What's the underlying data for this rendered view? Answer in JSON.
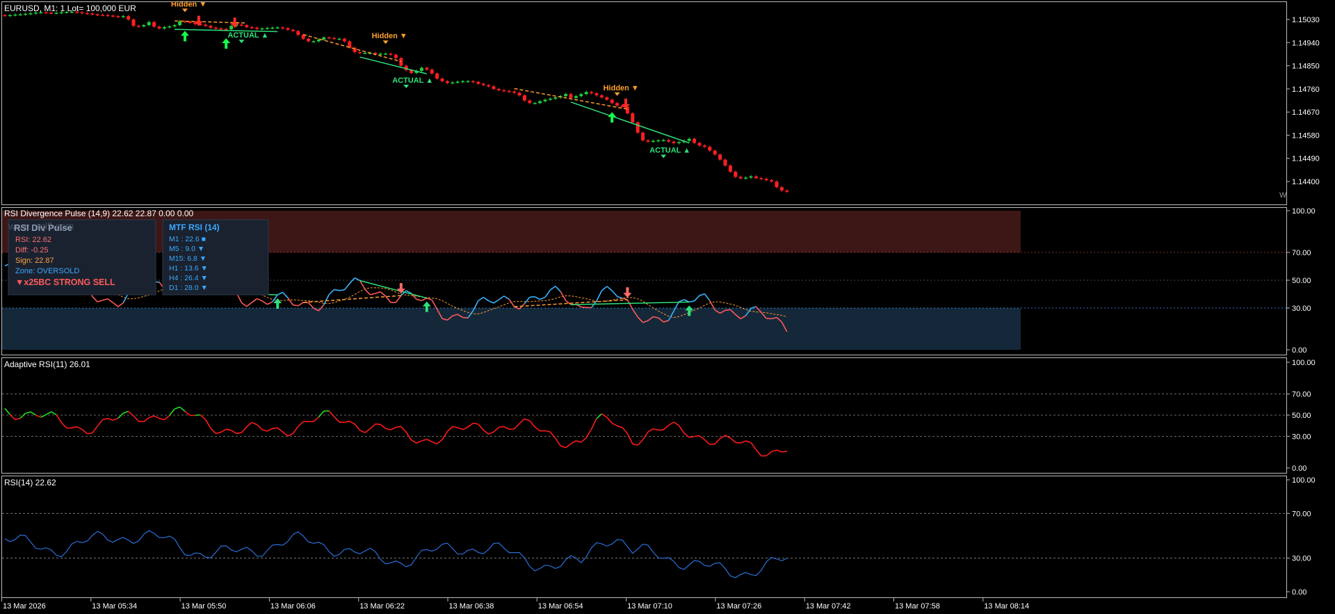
{
  "main": {
    "header": "EURUSD, M1:  1 Lot= 100,000 EUR",
    "price_ticks": [
      "1.15030",
      "1.14940",
      "1.14850",
      "1.14760",
      "1.14670",
      "1.14580",
      "1.14490",
      "1.14400"
    ],
    "labels": [
      {
        "text": "Hidden ▼",
        "kind": "hidden"
      },
      {
        "text": "Hidden ▼",
        "kind": "hidden"
      },
      {
        "text": "Hidden ▼",
        "kind": "hidden"
      },
      {
        "text": "ACTUAL ▲",
        "kind": "actual"
      },
      {
        "text": "ACTUAL ▲",
        "kind": "actual"
      },
      {
        "text": "ACTUAL ▲",
        "kind": "actual"
      }
    ],
    "corner_text": "W"
  },
  "rsi_div": {
    "header": "RSI Divergence Pulse (14,9) 22.62 22.87 0.00 0.00",
    "ticks": [
      "100.00",
      "70.00",
      "50.00",
      "30.00",
      "0.00"
    ],
    "watermark": "www.mql5.com",
    "info_panel": {
      "title": "RSI Div Pulse",
      "rows": [
        {
          "label": "RSI:  22.62",
          "color": "#ff6e6e"
        },
        {
          "label": "Diff: -0.25",
          "color": "#ff6e6e"
        },
        {
          "label": "Sign: 22.87",
          "color": "#ffa040"
        },
        {
          "label": "Zone: OVERSOLD",
          "color": "#3aa8ff"
        }
      ],
      "signal": "▼x25BC STRONG SELL"
    },
    "mtf_panel": {
      "title": "MTF RSI (14)",
      "rows": [
        "M1  : 22.6 ■",
        "M5  : 9.0 ▼",
        "M15: 6.8 ▼",
        "H1  : 13.6 ▼",
        "H4  : 26.4 ▼",
        "D1  : 28.0 ▼"
      ]
    }
  },
  "adaptive": {
    "header": "Adaptive RSI(11) 26.01",
    "ticks": [
      "100.00",
      "70.00",
      "50.00",
      "30.00",
      "0.00"
    ]
  },
  "rsi14": {
    "header": "RSI(14) 22.62",
    "ticks": [
      "100.00",
      "70.00",
      "30.00",
      "0.00"
    ]
  },
  "time_axis": [
    "13 Mar 2026",
    "13 Mar 05:34",
    "13 Mar 05:50",
    "13 Mar 06:06",
    "13 Mar 06:22",
    "13 Mar 06:38",
    "13 Mar 06:54",
    "13 Mar 07:10",
    "13 Mar 07:26",
    "13 Mar 07:42",
    "13 Mar 07:58",
    "13 Mar 08:14"
  ],
  "chart_data": {
    "type": "candlestick",
    "symbol": "EURUSD",
    "timeframe": "M1",
    "close_approx": [
      1.15045,
      1.15047,
      1.15049,
      1.1505,
      1.15052,
      1.15054,
      1.15057,
      1.15058,
      1.15056,
      1.15055,
      1.15056,
      1.15058,
      1.15059,
      1.1506,
      1.15058,
      1.15055,
      1.15053,
      1.1505,
      1.15048,
      1.15047,
      1.15045,
      1.15043,
      1.1504,
      1.15043,
      1.1503,
      1.15005,
      1.15003,
      1.15008,
      1.1502,
      1.15002,
      1.14995,
      1.15,
      1.15003,
      1.15008,
      1.15023,
      1.15021,
      1.15018,
      1.15012,
      1.1501,
      1.15005,
      1.14998,
      1.14995,
      1.14993,
      1.14992,
      1.15005,
      1.1501,
      1.15008,
      1.15,
      1.14998,
      1.14993,
      1.14995,
      1.14997,
      1.14998,
      1.14999,
      1.14996,
      1.1499,
      1.14985,
      1.1497,
      1.14955,
      1.14945,
      1.14945,
      1.14952,
      1.1496,
      1.14958,
      1.14955,
      1.14955,
      1.14945,
      1.1492,
      1.14903,
      1.149,
      1.149,
      1.149,
      1.14895,
      1.14897,
      1.14897,
      1.14893,
      1.1488,
      1.1485,
      1.14833,
      1.14822,
      1.1483,
      1.14842,
      1.14835,
      1.1482,
      1.148,
      1.1479,
      1.14783,
      1.14785,
      1.14788,
      1.1479,
      1.1479,
      1.14787,
      1.1478,
      1.14775,
      1.1477,
      1.1476,
      1.14755,
      1.14752,
      1.1475,
      1.14745,
      1.14735,
      1.14715,
      1.14705,
      1.14705,
      1.14712,
      1.14718,
      1.14722,
      1.14727,
      1.14732,
      1.1474,
      1.14725,
      1.14732,
      1.1474,
      1.14748,
      1.14743,
      1.14735,
      1.14727,
      1.14718,
      1.14705,
      1.14695,
      1.1469,
      1.14665,
      1.1463,
      1.1459,
      1.1456,
      1.14555,
      1.14558,
      1.1456,
      1.14561,
      1.14555,
      1.14549,
      1.14553,
      1.14558,
      1.14566,
      1.1455,
      1.1454,
      1.14535,
      1.1452,
      1.14505,
      1.14485,
      1.14462,
      1.14438,
      1.14418,
      1.14412,
      1.14415,
      1.1442,
      1.14413,
      1.1441,
      1.14405,
      1.144,
      1.14378,
      1.14365,
      1.1436
    ]
  }
}
